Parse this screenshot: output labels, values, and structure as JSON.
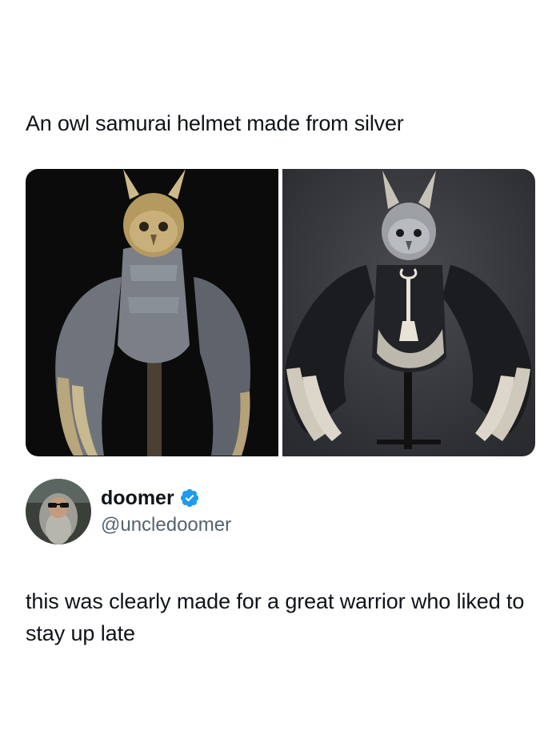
{
  "post": {
    "caption": "An owl samurai helmet made from silver",
    "images": [
      {
        "name": "owl-armor-dark-photo",
        "background": "#0d0d0d"
      },
      {
        "name": "owl-armor-gray-photo",
        "background": "#3a3b3f"
      }
    ]
  },
  "author": {
    "display_name": "doomer",
    "handle": "@uncledoomer",
    "verified_icon": "verified-badge-icon",
    "verified_color": "#1d9bf0"
  },
  "tweet": {
    "text": "this was clearly made for a great warrior who liked to stay up late"
  },
  "colors": {
    "text_primary": "#0f1419",
    "text_secondary": "#536471",
    "background": "#ffffff"
  }
}
